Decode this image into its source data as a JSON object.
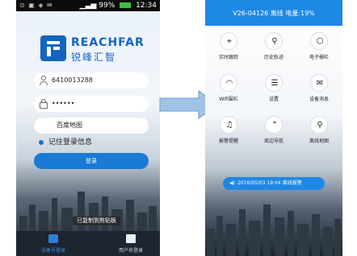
{
  "left_screen": {
    "status_bar": {
      "clock": "12:34",
      "battery": "99%"
    },
    "logo": {
      "brand_en": "REACHFAR",
      "brand_cn": "锐峰汇智"
    },
    "login_form": {
      "account_value": "6410013288",
      "password_value": "••••••",
      "map_value": "百度地图",
      "remember_label": "记住登录信息",
      "login_button_label": "登录"
    },
    "toast": "已复制到剪贴板",
    "bottom_tabs": [
      {
        "label": "设备号登录"
      },
      {
        "label": "用户名登录"
      }
    ]
  },
  "right_screen": {
    "header_title": "V26-04126 离线 电量:19%",
    "grid": [
      {
        "label": "实时跟踪",
        "icon": "crosshair-icon",
        "glyph": "⌖"
      },
      {
        "label": "历史轨迹",
        "icon": "location-pin-icon",
        "glyph": "⚲"
      },
      {
        "label": "电子栅栏",
        "icon": "hexagon-icon",
        "glyph": "⬡"
      },
      {
        "label": "Wifi围栏",
        "icon": "wifi-icon",
        "glyph": "◠"
      },
      {
        "label": "设置",
        "icon": "sliders-icon",
        "glyph": "☰"
      },
      {
        "label": "设备消息",
        "icon": "envelope-icon",
        "glyph": "✉"
      },
      {
        "label": "报警提醒",
        "icon": "bell-icon",
        "glyph": "♫"
      },
      {
        "label": "周边导航",
        "icon": "navigation-icon",
        "glyph": "⌃"
      },
      {
        "label": "离线地图",
        "icon": "map-pin-icon",
        "glyph": "⚲"
      }
    ],
    "alarm_message": "2016/05/03 19:04 离线报警"
  },
  "colors": {
    "accent": "#1e88e5",
    "brand": "#1565c0",
    "arrow": "#9fc3e6"
  }
}
